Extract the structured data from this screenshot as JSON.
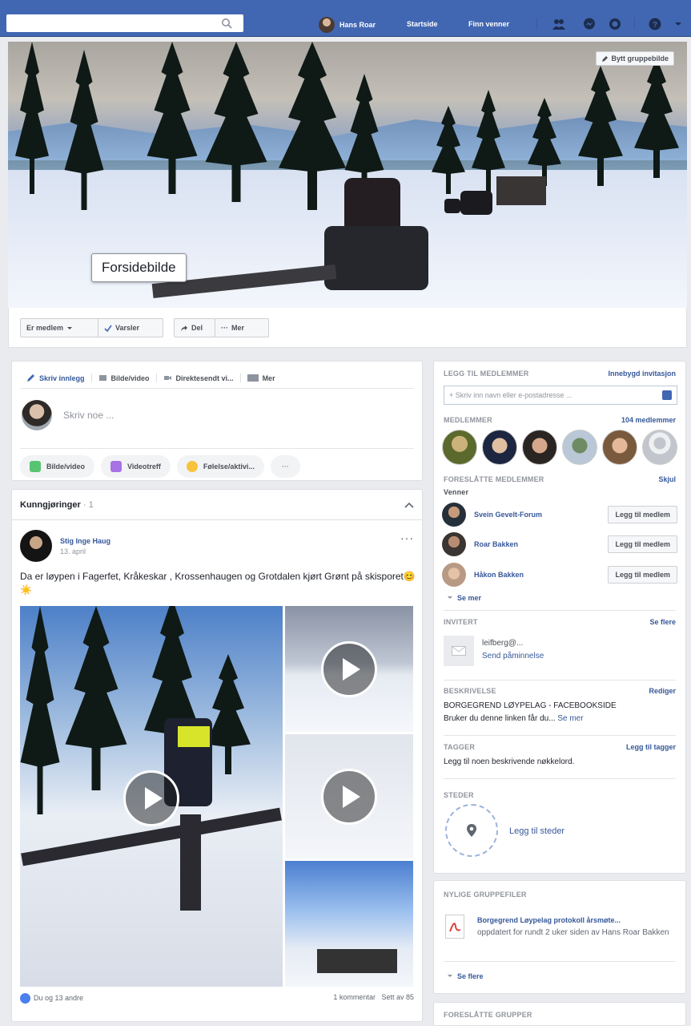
{
  "topbar": {
    "user_name": "Hans Roar",
    "home": "Startside",
    "find_friends": "Finn venner"
  },
  "cover": {
    "label": "Forsidebilde",
    "change_button": "Bytt gruppebilde"
  },
  "actions": {
    "membership": "Er medlem",
    "notifications": "Varsler",
    "share": "Del",
    "more": "Mer"
  },
  "composer": {
    "tabs": [
      "Skriv innlegg",
      "Bilde/video",
      "Direktesendt vi...",
      "Mer"
    ],
    "placeholder": "Skriv noe ...",
    "pills": [
      "Bilde/video",
      "Videotreff",
      "Følelse/aktivi..."
    ],
    "pill_more": "···"
  },
  "announcements": {
    "title": "Kunngjøringer",
    "count": "· 1",
    "post": {
      "author": "Stig Inge Haug",
      "date": "13. april",
      "text": "Da er løypen i Fagerfet, Kråkeskar , Krossenhaugen og Grotdalen kjørt Grønt på skisporet😊 ☀️",
      "reactions": "Du og 13 andre",
      "comments": "1 kommentar",
      "seen": "Sett av 85"
    }
  },
  "sidebar": {
    "add_members": {
      "title": "LEGG TIL MEDLEMMER",
      "link": "Innebygd invitasjon",
      "placeholder": "+ Skriv inn navn eller e-postadresse ..."
    },
    "members": {
      "title": "MEDLEMMER",
      "count": "104 medlemmer"
    },
    "suggested": {
      "title": "FORESLÅTTE MEDLEMMER",
      "hide": "Skjul",
      "subtitle": "Venner",
      "people": [
        {
          "name": "Svein Gevelt-Forum",
          "button": "Legg til medlem"
        },
        {
          "name": "Roar Bakken",
          "button": "Legg til medlem"
        },
        {
          "name": "Håkon Bakken",
          "button": "Legg til medlem"
        }
      ],
      "see_more": "Se mer"
    },
    "invited": {
      "title": "INVITERT",
      "link": "Se flere",
      "email": "leifberg@...",
      "action": "Send påminnelse"
    },
    "description": {
      "title": "BESKRIVELSE",
      "edit": "Rediger",
      "line1": "BORGEGREND LØYPELAG - FACEBOOKSIDE",
      "line2": "Bruker du denne linken får du...",
      "more": "Se mer"
    },
    "tags": {
      "title": "TAGGER",
      "link": "Legg til tagger",
      "text": "Legg til noen beskrivende nøkkelord."
    },
    "places": {
      "title": "STEDER",
      "link": "Legg til steder"
    },
    "files": {
      "title": "NYLIGE GRUPPEFILER",
      "file_name": "Borgegrend Løypelag protokoll årsmøte...",
      "file_meta": "oppdatert for rundt 2 uker siden av Hans Roar Bakken",
      "see_more": "Se flere"
    },
    "suggested_groups": {
      "title": "FORESLÅTTE GRUPPER"
    }
  },
  "colors": {
    "topbar": "#4267b2",
    "link": "#365899",
    "background": "#e9ebee"
  }
}
